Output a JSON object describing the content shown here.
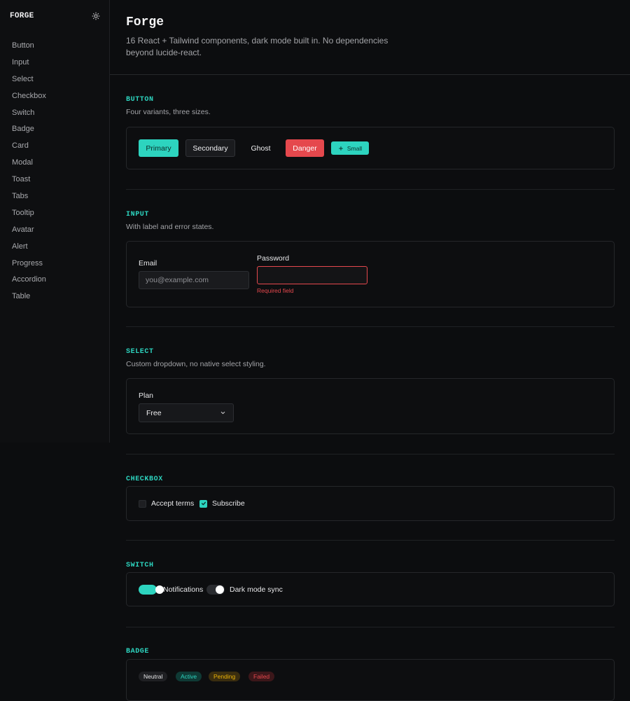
{
  "sidebar": {
    "brand": "FORGE",
    "theme_icon": "sun-icon",
    "items": [
      {
        "label": "Button"
      },
      {
        "label": "Input"
      },
      {
        "label": "Select"
      },
      {
        "label": "Checkbox"
      },
      {
        "label": "Switch"
      },
      {
        "label": "Badge"
      },
      {
        "label": "Card"
      },
      {
        "label": "Modal"
      },
      {
        "label": "Toast"
      },
      {
        "label": "Tabs"
      },
      {
        "label": "Tooltip"
      },
      {
        "label": "Avatar"
      },
      {
        "label": "Alert"
      },
      {
        "label": "Progress"
      },
      {
        "label": "Accordion"
      },
      {
        "label": "Table"
      }
    ]
  },
  "header": {
    "title": "Forge",
    "subtitle": "16 React + Tailwind components, dark mode built in. No dependencies beyond lucide-react."
  },
  "sections": {
    "button": {
      "title": "BUTTON",
      "desc": "Four variants, three sizes.",
      "primary": "Primary",
      "secondary": "Secondary",
      "ghost": "Ghost",
      "danger": "Danger",
      "small": "Small",
      "small_icon": "plus-icon"
    },
    "input": {
      "title": "INPUT",
      "desc": "With label and error states.",
      "email_label": "Email",
      "email_placeholder": "you@example.com",
      "email_value": "",
      "password_label": "Password",
      "password_value": "",
      "password_error": "Required field"
    },
    "select": {
      "title": "SELECT",
      "desc": "Custom dropdown, no native select styling.",
      "label": "Plan",
      "value": "Free",
      "icon": "chevron-down-icon"
    },
    "checkbox": {
      "title": "CHECKBOX",
      "items": [
        {
          "label": "Accept terms",
          "checked": false
        },
        {
          "label": "Subscribe",
          "checked": true
        }
      ]
    },
    "switch": {
      "title": "SWITCH",
      "items": [
        {
          "label": "Notifications",
          "on": true
        },
        {
          "label": "Dark mode sync",
          "on": false
        }
      ]
    },
    "badge": {
      "title": "BADGE",
      "items": [
        {
          "label": "Neutral"
        },
        {
          "label": "Active"
        },
        {
          "label": "Pending"
        },
        {
          "label": "Failed"
        }
      ]
    }
  },
  "colors": {
    "accent": "#2dd4bf",
    "danger": "#e5484d",
    "background": "#0c0d0f"
  }
}
